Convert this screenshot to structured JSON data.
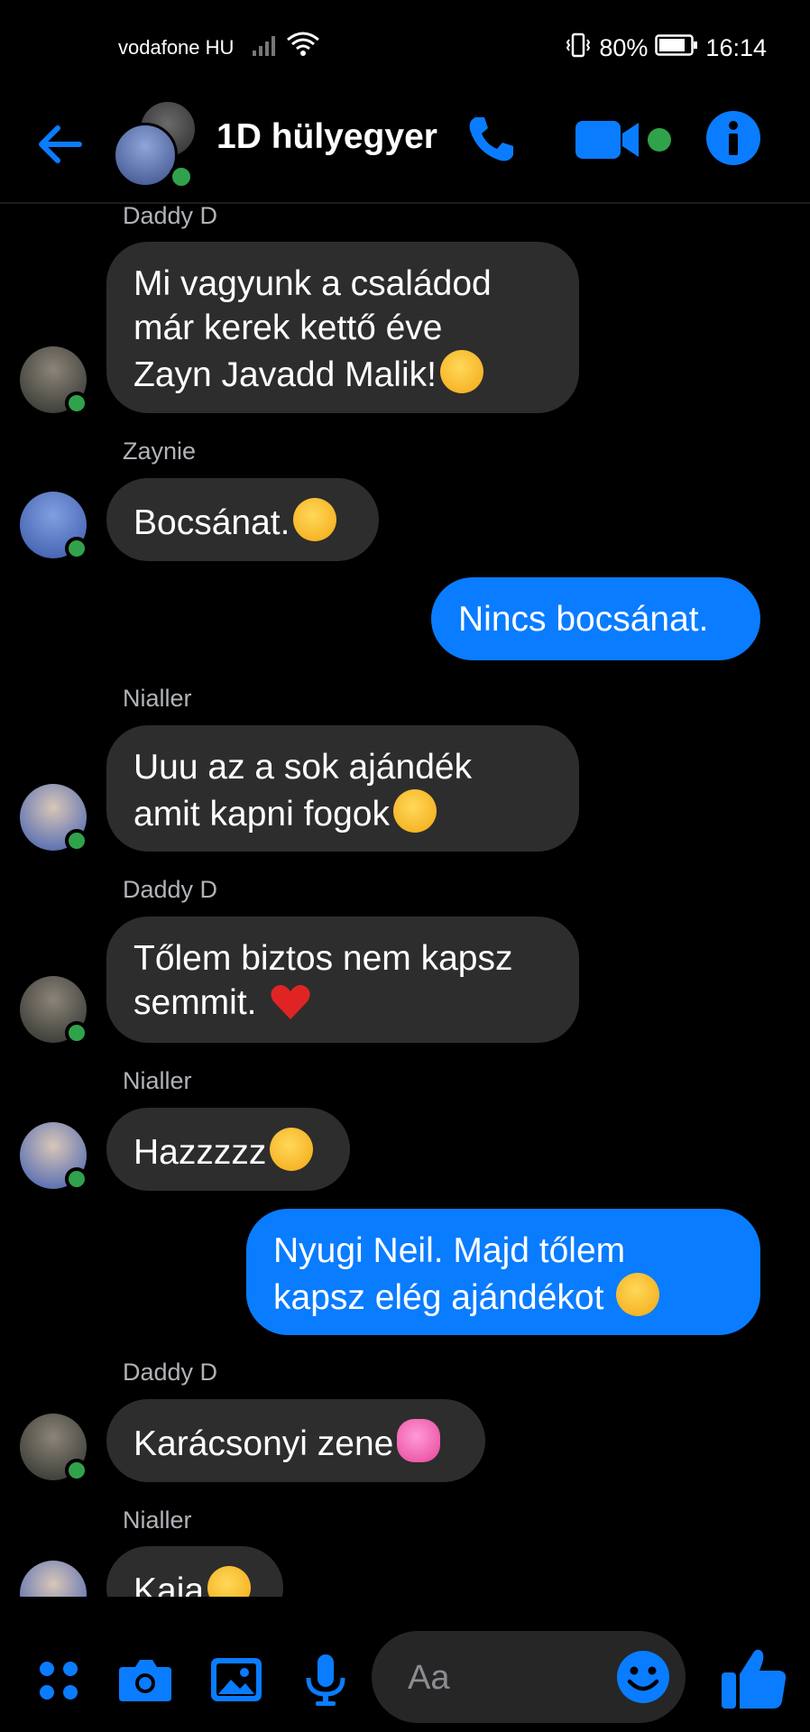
{
  "status_bar": {
    "carrier": "vodafone HU",
    "battery": "80%",
    "time": "16:14"
  },
  "header": {
    "title": "1D hülyegyer"
  },
  "messages": [
    {
      "sender": "Daddy D",
      "lines": [
        "Mi vagyunk a családod",
        "már kerek kettő éve",
        "Zayn Javadd Malik!"
      ],
      "emoji": "angry-steam-emoji"
    },
    {
      "sender": "Zaynie",
      "lines": [
        "Bocsánat."
      ],
      "emoji": "eye-roll-emoji"
    },
    {
      "sender": "",
      "lines": [
        "Nincs bocsánat."
      ],
      "outgoing": true
    },
    {
      "sender": "Nialler",
      "lines": [
        "Uuu az a sok ajándék",
        "amit kapni fogok"
      ],
      "emoji": "grin-emoji"
    },
    {
      "sender": "Daddy D",
      "lines": [
        "Tőlem biztos nem kapsz",
        "semmit."
      ],
      "emoji": "red-heart-emoji"
    },
    {
      "sender": "Nialler",
      "lines": [
        "Hazzzzz"
      ],
      "emoji": "loud-crying-emoji"
    },
    {
      "sender": "",
      "lines": [
        "Nyugi Neil. Majd tőlem",
        "kapsz elég ajándékot"
      ],
      "outgoing": true,
      "emoji": "heart-eyes-emoji"
    },
    {
      "sender": "Daddy D",
      "lines": [
        "Karácsonyi zene"
      ],
      "emoji": "two-hearts-emoji"
    },
    {
      "sender": "Nialler",
      "lines": [
        "Kaja"
      ],
      "emoji": "drooling-emoji"
    }
  ],
  "composer": {
    "placeholder": "Aa"
  },
  "colors": {
    "accent": "#0a7cff",
    "incoming_bubble": "#2d2d2d",
    "online": "#31a24c",
    "background": "#000000"
  }
}
